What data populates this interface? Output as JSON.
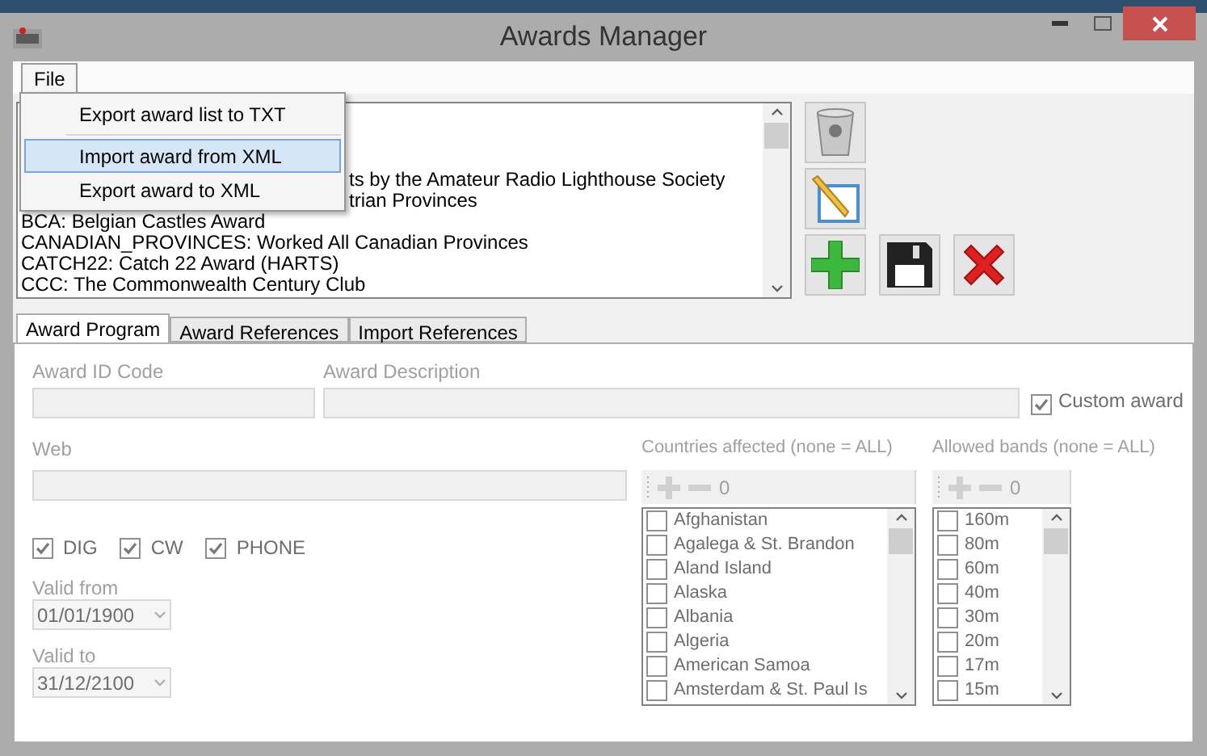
{
  "window": {
    "title": "Awards Manager"
  },
  "menu": [
    {
      "label": "File",
      "selected": true
    }
  ],
  "file_menu": [
    {
      "kind": "item",
      "label": "Export award list to TXT",
      "selected": false
    },
    {
      "kind": "separator"
    },
    {
      "kind": "item",
      "label": "Import award from XML",
      "selected": true
    },
    {
      "kind": "item",
      "label": "Export award to XML",
      "selected": false
    }
  ],
  "award_list": [
    {
      "kind": "covered",
      "text": "ts by the Amateur Radio Lighthouse Society"
    },
    {
      "kind": "covered",
      "text": "trian Provinces"
    },
    {
      "kind": "full",
      "text": "BCA: Belgian Castles Award"
    },
    {
      "kind": "full",
      "text": "CANADIAN_PROVINCES: Worked All Canadian Provinces"
    },
    {
      "kind": "full",
      "text": "CATCH22: Catch 22 Award (HARTS)"
    },
    {
      "kind": "full",
      "text": "CCC: The Commonwealth Century Club"
    }
  ],
  "tabs": [
    {
      "label": "Award Program",
      "selected": true
    },
    {
      "label": "Award References",
      "selected": false
    },
    {
      "label": "Import References",
      "selected": false
    }
  ],
  "form": {
    "award_id_label": "Award ID Code",
    "award_description_label": "Award Description",
    "custom_award": {
      "label": "Custom award",
      "checked": true
    },
    "web_label": "Web",
    "modes": [
      {
        "label": "DIG",
        "checked": true
      },
      {
        "label": "CW",
        "checked": true
      },
      {
        "label": "PHONE",
        "checked": true
      }
    ],
    "valid_from": {
      "label": "Valid from",
      "value": "01/01/1900"
    },
    "valid_to": {
      "label": "Valid to",
      "value": "31/12/2100"
    }
  },
  "countries": {
    "label": "Countries affected (none = ALL)",
    "count": "0",
    "items": [
      {
        "label": "Afghanistan",
        "checked": false
      },
      {
        "label": "Agalega & St. Brandon",
        "checked": false
      },
      {
        "label": "Aland Island",
        "checked": false
      },
      {
        "label": "Alaska",
        "checked": false
      },
      {
        "label": "Albania",
        "checked": false
      },
      {
        "label": "Algeria",
        "checked": false
      },
      {
        "label": "American Samoa",
        "checked": false
      },
      {
        "label": "Amsterdam & St. Paul Is",
        "checked": false
      }
    ]
  },
  "bands": {
    "label": "Allowed bands (none = ALL)",
    "count": "0",
    "items": [
      {
        "label": "160m",
        "checked": false
      },
      {
        "label": "80m",
        "checked": false
      },
      {
        "label": "60m",
        "checked": false
      },
      {
        "label": "40m",
        "checked": false
      },
      {
        "label": "30m",
        "checked": false
      },
      {
        "label": "20m",
        "checked": false
      },
      {
        "label": "17m",
        "checked": false
      },
      {
        "label": "15m",
        "checked": false
      }
    ]
  }
}
